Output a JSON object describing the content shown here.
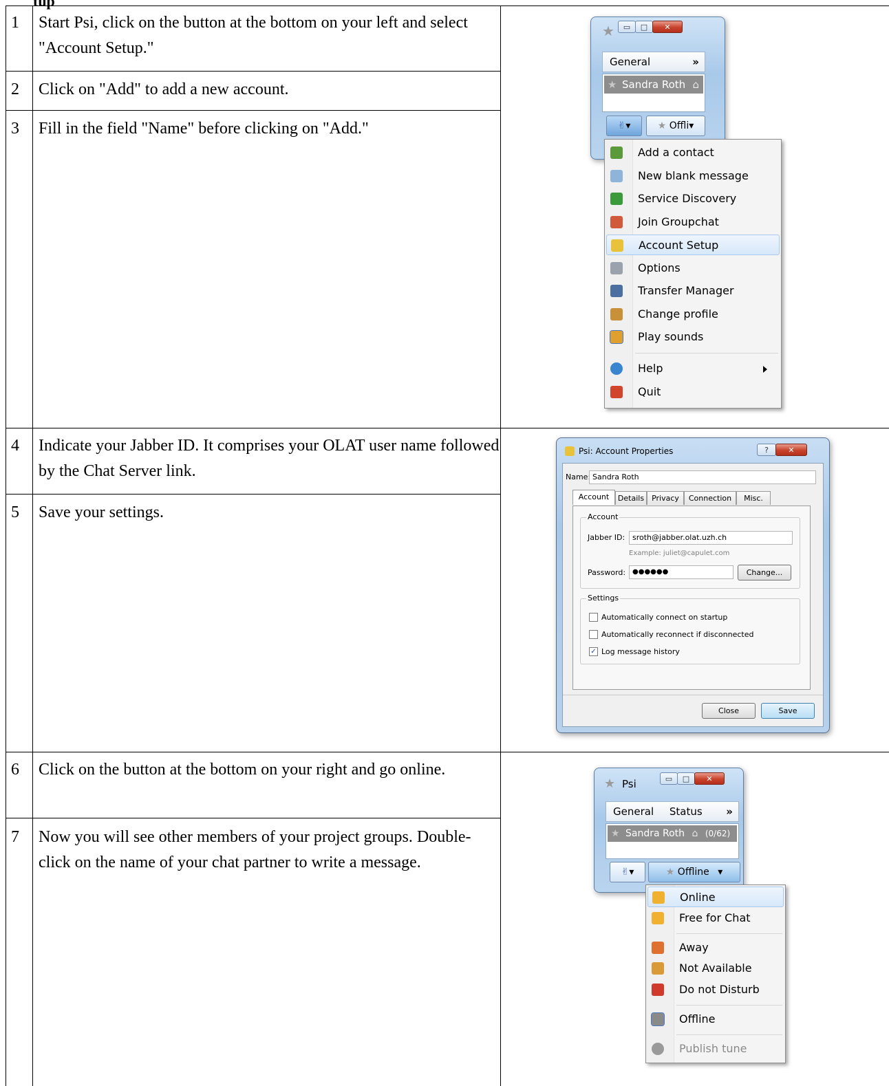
{
  "header_fragment": "tup",
  "steps": [
    {
      "num": "1",
      "text": "Start Psi, click on the button at the bottom on your left and select \"Account Setup.\""
    },
    {
      "num": "2",
      "text": "Click on \"Add\" to add a new account."
    },
    {
      "num": "3",
      "text": "Fill in the field \"Name\" before clicking on \"Add.\""
    },
    {
      "num": "4",
      "text": "Indicate your Jabber ID. It comprises your OLAT user name followed by the Chat Server link."
    },
    {
      "num": "5",
      "text": "Save your settings."
    },
    {
      "num": "6",
      "text": "Click on the button at the bottom on your right and go online."
    },
    {
      "num": "7",
      "text": "Now you will see other members of your project groups. Double-click on the name of your chat partner to write a message."
    }
  ],
  "shot1": {
    "tab_label": "General",
    "more_glyph": "»",
    "contact": "Sandra Roth",
    "status_button": "Offli",
    "menu": [
      {
        "label": "Add a contact",
        "icon": "add-contact-icon",
        "color": "#5a9a3a"
      },
      {
        "label": "New blank message",
        "icon": "envelope-icon",
        "color": "#8fb3d9"
      },
      {
        "label": "Service Discovery",
        "icon": "service-discovery-icon",
        "color": "#3b9a3b"
      },
      {
        "label": "Join Groupchat",
        "icon": "groupchat-icon",
        "color": "#d05a3a"
      },
      {
        "label": "Account Setup",
        "icon": "account-setup-icon",
        "color": "#e7c23a"
      },
      {
        "label": "Options",
        "icon": "wrench-icon",
        "color": "#9aa3ad"
      },
      {
        "label": "Transfer Manager",
        "icon": "floppy-icon",
        "color": "#4a6fa0"
      },
      {
        "label": "Change profile",
        "icon": "profile-icon",
        "color": "#c9903a"
      },
      {
        "label": "Play sounds",
        "icon": "sound-icon",
        "color": "#e0a030"
      },
      {
        "label": "Help",
        "icon": "help-icon",
        "color": "#3a85d0"
      },
      {
        "label": "Quit",
        "icon": "quit-icon",
        "color": "#d0452c"
      }
    ]
  },
  "shot2": {
    "title": "Psi: Account Properties",
    "help_glyph": "?",
    "name_label": "Name:",
    "name_value": "Sandra Roth",
    "tabs": [
      "Account",
      "Details",
      "Privacy",
      "Connection",
      "Misc."
    ],
    "account_group": "Account",
    "jid_label": "Jabber ID:",
    "jid_value": "sroth@jabber.olat.uzh.ch",
    "jid_example": "Example: juliet@capulet.com",
    "password_label": "Password:",
    "password_value": "●●●●●●",
    "change_button": "Change...",
    "settings_group": "Settings",
    "checks": [
      {
        "label": "Automatically connect on startup",
        "checked": false
      },
      {
        "label": "Automatically reconnect if disconnected",
        "checked": false
      },
      {
        "label": "Log message history",
        "checked": true
      }
    ],
    "close_button": "Close",
    "save_button": "Save"
  },
  "shot3": {
    "title": "Psi",
    "tabs": [
      "General",
      "Status"
    ],
    "more_glyph": "»",
    "contact": "Sandra Roth",
    "contact_count": "(0/62)",
    "status_button": "Offline",
    "menu": [
      {
        "label": "Online",
        "icon": "online-star-icon",
        "color": "#f0b030"
      },
      {
        "label": "Free for Chat",
        "icon": "free-chat-star-icon",
        "color": "#f0b030"
      },
      {
        "label": "Away",
        "icon": "away-star-icon",
        "color": "#e07030"
      },
      {
        "label": "Not Available",
        "icon": "not-available-star-icon",
        "color": "#d99a3a"
      },
      {
        "label": "Do not Disturb",
        "icon": "dnd-star-icon",
        "color": "#d03a2c"
      },
      {
        "label": "Offline",
        "icon": "offline-star-icon",
        "color": "#8a8a8a"
      },
      {
        "label": "Publish tune",
        "icon": "tune-icon",
        "color": "#9a9a9a"
      }
    ]
  }
}
